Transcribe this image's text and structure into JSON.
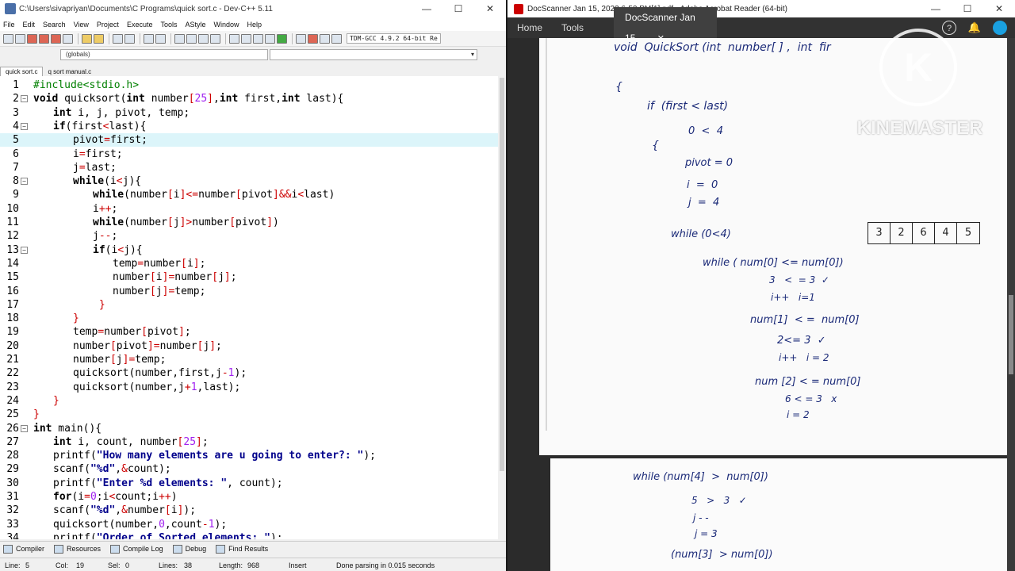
{
  "devcpp": {
    "title": "C:\\Users\\sivapriyan\\Documents\\C Programs\\quick sort.c - Dev-C++ 5.11",
    "window_buttons": [
      "—",
      "☐",
      "✕"
    ],
    "menu": [
      "File",
      "Edit",
      "Search",
      "View",
      "Project",
      "Execute",
      "Tools",
      "AStyle",
      "Window",
      "Help"
    ],
    "compiler": "TDM-GCC 4.9.2 64-bit Re",
    "scope": "(globals)",
    "file_tabs": [
      "quick sort.c",
      "q sort manual.c"
    ],
    "code": [
      {
        "n": "1",
        "fold": "",
        "indent": 0,
        "parts": [
          [
            "pp",
            "#include<stdio.h>"
          ]
        ]
      },
      {
        "n": "2",
        "fold": "⊟",
        "indent": 0,
        "parts": [
          [
            "kw",
            "void"
          ],
          [
            "",
            " quicksort("
          ],
          [
            "kw",
            "int"
          ],
          [
            "",
            " number"
          ],
          [
            "sym",
            "["
          ],
          [
            "nm",
            "25"
          ],
          [
            "sym",
            "]"
          ],
          [
            "",
            ","
          ],
          [
            "kw",
            "int"
          ],
          [
            "",
            " first,"
          ],
          [
            "kw",
            "int"
          ],
          [
            "",
            " last){"
          ]
        ]
      },
      {
        "n": "3",
        "fold": "",
        "indent": 1,
        "parts": [
          [
            "kw",
            "int"
          ],
          [
            "",
            " i, j, pivot, temp;"
          ]
        ]
      },
      {
        "n": "4",
        "fold": "⊟",
        "indent": 1,
        "parts": [
          [
            "kw",
            "if"
          ],
          [
            "",
            "(first"
          ],
          [
            "sym",
            "<"
          ],
          [
            "",
            "last){"
          ]
        ]
      },
      {
        "n": "5",
        "fold": "",
        "indent": 2,
        "parts": [
          [
            "",
            "pivot"
          ],
          [
            "sym",
            "="
          ],
          [
            "",
            "first;"
          ]
        ]
      },
      {
        "n": "6",
        "fold": "",
        "indent": 2,
        "parts": [
          [
            "",
            "i"
          ],
          [
            "sym",
            "="
          ],
          [
            "",
            "first;"
          ]
        ]
      },
      {
        "n": "7",
        "fold": "",
        "indent": 2,
        "parts": [
          [
            "",
            "j"
          ],
          [
            "sym",
            "="
          ],
          [
            "",
            "last;"
          ]
        ]
      },
      {
        "n": "8",
        "fold": "⊟",
        "indent": 2,
        "parts": [
          [
            "kw",
            "while"
          ],
          [
            "",
            "(i"
          ],
          [
            "sym",
            "<"
          ],
          [
            "",
            "j){"
          ]
        ]
      },
      {
        "n": "9",
        "fold": "",
        "indent": 3,
        "parts": [
          [
            "kw",
            "while"
          ],
          [
            "",
            "(number"
          ],
          [
            "sym",
            "["
          ],
          [
            "",
            "i"
          ],
          [
            "sym",
            "]<="
          ],
          [
            "",
            "number"
          ],
          [
            "sym",
            "["
          ],
          [
            "",
            "pivot"
          ],
          [
            "sym",
            "]&&"
          ],
          [
            "",
            "i"
          ],
          [
            "sym",
            "<"
          ],
          [
            "",
            "last)"
          ]
        ]
      },
      {
        "n": "10",
        "fold": "",
        "indent": 3,
        "parts": [
          [
            "",
            "i"
          ],
          [
            "sym",
            "++"
          ],
          [
            "",
            ";"
          ]
        ]
      },
      {
        "n": "11",
        "fold": "",
        "indent": 3,
        "parts": [
          [
            "kw",
            "while"
          ],
          [
            "",
            "(number"
          ],
          [
            "sym",
            "["
          ],
          [
            "",
            "j"
          ],
          [
            "sym",
            "]>"
          ],
          [
            "",
            "number"
          ],
          [
            "sym",
            "["
          ],
          [
            "",
            "pivot"
          ],
          [
            "sym",
            "]"
          ],
          [
            "",
            ")"
          ]
        ]
      },
      {
        "n": "12",
        "fold": "",
        "indent": 3,
        "parts": [
          [
            "",
            "j"
          ],
          [
            "sym",
            "--"
          ],
          [
            "",
            ";"
          ]
        ]
      },
      {
        "n": "13",
        "fold": "⊟",
        "indent": 3,
        "parts": [
          [
            "kw",
            "if"
          ],
          [
            "",
            "(i"
          ],
          [
            "sym",
            "<"
          ],
          [
            "",
            "j){"
          ]
        ]
      },
      {
        "n": "14",
        "fold": "",
        "indent": 4,
        "parts": [
          [
            "",
            "temp"
          ],
          [
            "sym",
            "="
          ],
          [
            "",
            "number"
          ],
          [
            "sym",
            "["
          ],
          [
            "",
            "i"
          ],
          [
            "sym",
            "]"
          ],
          [
            "",
            ";"
          ]
        ]
      },
      {
        "n": "15",
        "fold": "",
        "indent": 4,
        "parts": [
          [
            "",
            "number"
          ],
          [
            "sym",
            "["
          ],
          [
            "",
            "i"
          ],
          [
            "sym",
            "]="
          ],
          [
            "",
            "number"
          ],
          [
            "sym",
            "["
          ],
          [
            "",
            "j"
          ],
          [
            "sym",
            "]"
          ],
          [
            "",
            ";"
          ]
        ]
      },
      {
        "n": "16",
        "fold": "",
        "indent": 4,
        "parts": [
          [
            "",
            "number"
          ],
          [
            "sym",
            "["
          ],
          [
            "",
            "j"
          ],
          [
            "sym",
            "]="
          ],
          [
            "",
            "temp;"
          ]
        ]
      },
      {
        "n": "17",
        "fold": "",
        "indent": 3,
        "parts": [
          [
            "",
            " "
          ],
          [
            "sym",
            "}"
          ]
        ]
      },
      {
        "n": "18",
        "fold": "",
        "indent": 2,
        "parts": [
          [
            "sym",
            "}"
          ]
        ]
      },
      {
        "n": "19",
        "fold": "",
        "indent": 2,
        "parts": [
          [
            "",
            "temp"
          ],
          [
            "sym",
            "="
          ],
          [
            "",
            "number"
          ],
          [
            "sym",
            "["
          ],
          [
            "",
            "pivot"
          ],
          [
            "sym",
            "]"
          ],
          [
            "",
            ";"
          ]
        ]
      },
      {
        "n": "20",
        "fold": "",
        "indent": 2,
        "parts": [
          [
            "",
            "number"
          ],
          [
            "sym",
            "["
          ],
          [
            "",
            "pivot"
          ],
          [
            "sym",
            "]="
          ],
          [
            "",
            "number"
          ],
          [
            "sym",
            "["
          ],
          [
            "",
            "j"
          ],
          [
            "sym",
            "]"
          ],
          [
            "",
            ";"
          ]
        ]
      },
      {
        "n": "21",
        "fold": "",
        "indent": 2,
        "parts": [
          [
            "",
            "number"
          ],
          [
            "sym",
            "["
          ],
          [
            "",
            "j"
          ],
          [
            "sym",
            "]="
          ],
          [
            "",
            "temp;"
          ]
        ]
      },
      {
        "n": "22",
        "fold": "",
        "indent": 2,
        "parts": [
          [
            "",
            "quicksort(number,first,j"
          ],
          [
            "sym",
            "-"
          ],
          [
            "nm",
            "1"
          ],
          [
            "",
            ");"
          ]
        ]
      },
      {
        "n": "23",
        "fold": "",
        "indent": 2,
        "parts": [
          [
            "",
            "quicksort(number,j"
          ],
          [
            "sym",
            "+"
          ],
          [
            "nm",
            "1"
          ],
          [
            "",
            ",last);"
          ]
        ]
      },
      {
        "n": "24",
        "fold": "",
        "indent": 1,
        "parts": [
          [
            "sym",
            "}"
          ]
        ]
      },
      {
        "n": "25",
        "fold": "",
        "indent": 0,
        "parts": [
          [
            "sym",
            "}"
          ]
        ]
      },
      {
        "n": "26",
        "fold": "⊟",
        "indent": 0,
        "parts": [
          [
            "kw",
            "int"
          ],
          [
            "",
            " main(){"
          ]
        ]
      },
      {
        "n": "27",
        "fold": "",
        "indent": 1,
        "parts": [
          [
            "kw",
            "int"
          ],
          [
            "",
            " i, count, number"
          ],
          [
            "sym",
            "["
          ],
          [
            "nm",
            "25"
          ],
          [
            "sym",
            "]"
          ],
          [
            "",
            ";"
          ]
        ]
      },
      {
        "n": "28",
        "fold": "",
        "indent": 1,
        "parts": [
          [
            "",
            "printf("
          ],
          [
            "st",
            "\"How many elements are u going to enter?: \""
          ],
          [
            "",
            ");"
          ]
        ]
      },
      {
        "n": "29",
        "fold": "",
        "indent": 1,
        "parts": [
          [
            "",
            "scanf("
          ],
          [
            "st",
            "\"%d\""
          ],
          [
            "",
            ","
          ],
          [
            "sym",
            "&"
          ],
          [
            "",
            "count);"
          ]
        ]
      },
      {
        "n": "30",
        "fold": "",
        "indent": 1,
        "parts": [
          [
            "",
            "printf("
          ],
          [
            "st",
            "\"Enter %d elements: \""
          ],
          [
            "",
            ", count);"
          ]
        ]
      },
      {
        "n": "31",
        "fold": "",
        "indent": 1,
        "parts": [
          [
            "kw",
            "for"
          ],
          [
            "",
            "(i"
          ],
          [
            "sym",
            "="
          ],
          [
            "nm",
            "0"
          ],
          [
            "",
            ";i"
          ],
          [
            "sym",
            "<"
          ],
          [
            "",
            "count;i"
          ],
          [
            "sym",
            "++"
          ],
          [
            "",
            ")"
          ]
        ]
      },
      {
        "n": "32",
        "fold": "",
        "indent": 1,
        "parts": [
          [
            "",
            "scanf("
          ],
          [
            "st",
            "\"%d\""
          ],
          [
            "",
            ","
          ],
          [
            "sym",
            "&"
          ],
          [
            "",
            "number"
          ],
          [
            "sym",
            "["
          ],
          [
            "",
            "i"
          ],
          [
            "sym",
            "]"
          ],
          [
            "",
            ");"
          ]
        ]
      },
      {
        "n": "33",
        "fold": "",
        "indent": 1,
        "parts": [
          [
            "",
            "quicksort(number,"
          ],
          [
            "nm",
            "0"
          ],
          [
            "",
            ",count"
          ],
          [
            "sym",
            "-"
          ],
          [
            "nm",
            "1"
          ],
          [
            "",
            ");"
          ]
        ]
      },
      {
        "n": "34",
        "fold": "",
        "indent": 1,
        "parts": [
          [
            "",
            "printf("
          ],
          [
            "st",
            "\"Order of Sorted elements: \""
          ],
          [
            "",
            ");"
          ]
        ]
      }
    ],
    "highlighted_line": 5,
    "bottom_tabs": [
      "Compiler",
      "Resources",
      "Compile Log",
      "Debug",
      "Find Results"
    ],
    "status": {
      "line_label": "Line:",
      "line": "5",
      "col_label": "Col:",
      "col": "19",
      "sel_label": "Sel:",
      "sel": "0",
      "lines_label": "Lines:",
      "lines": "38",
      "length_label": "Length:",
      "length": "968",
      "mode": "Insert",
      "message": "Done parsing in 0.015 seconds"
    }
  },
  "acrobat": {
    "title": "DocScanner Jan 15, 2023 6-52 PM[1].pdf - Adobe Acrobat Reader (64-bit)",
    "nav": {
      "home": "Home",
      "tools": "Tools",
      "doc_tab": "DocScanner Jan 15...",
      "close": "✕"
    },
    "window_buttons": [
      "—",
      "☐",
      "✕"
    ],
    "icons": {
      "help": "?",
      "bell": "🔔"
    },
    "page1_notes": [
      "void  QuickSort (int  number[ ] ,  int  fir",
      "{",
      "if  (first < last)",
      "0  <  4",
      "{",
      "pivot = 0",
      "i  =  0",
      "j  =  4",
      "while (0<4)",
      "while ( num[0] <= num[0])",
      "3   <  = 3  ✓",
      "i++   i=1",
      "num[1]  < =  num[0]",
      "2<= 3  ✓",
      "i++   i = 2",
      "num [2] < = num[0]",
      "6 < = 3   x",
      "i = 2"
    ],
    "array": [
      "3",
      "2",
      "6",
      "4",
      "5"
    ],
    "page2_notes": [
      "while (num[4]  >  num[0])",
      "5   >   3   ✓",
      "j - -",
      "j = 3",
      "(num[3]  > num[0])"
    ]
  },
  "watermark": {
    "brand": "KINEMASTER",
    "logo_letter": "K"
  }
}
